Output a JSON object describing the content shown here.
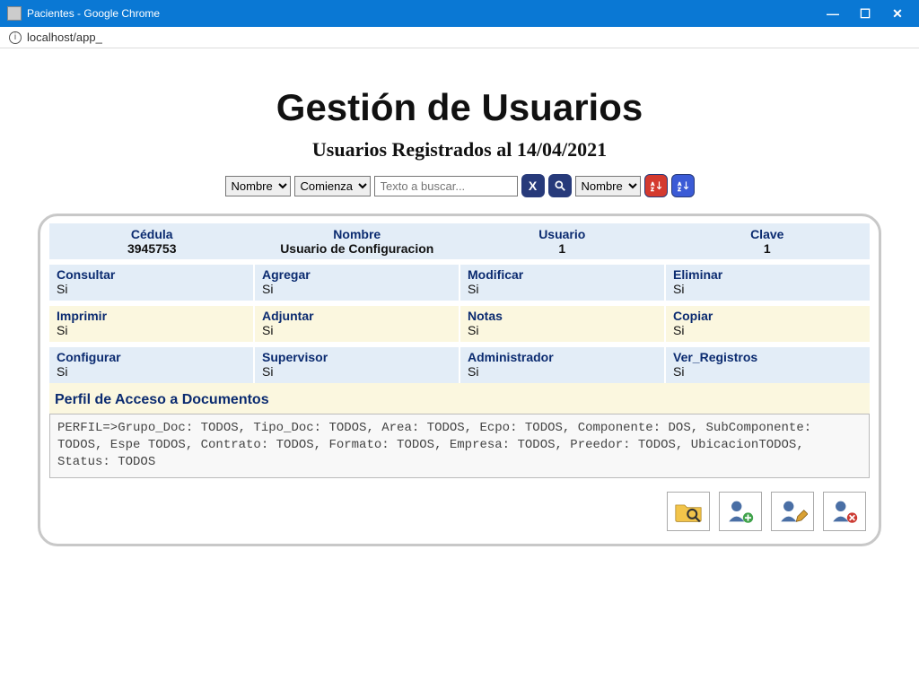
{
  "window": {
    "title": "Pacientes - Google Chrome",
    "url": "localhost/app_"
  },
  "page": {
    "title": "Gestión de Usuarios",
    "subtitle": "Usuarios Registrados al 14/04/2021"
  },
  "search": {
    "field1_option": "Nombre",
    "match_option": "Comienza",
    "placeholder": "Texto a buscar...",
    "value": "",
    "field2_option": "Nombre"
  },
  "header": {
    "cells": [
      {
        "label": "Cédula",
        "value": "3945753"
      },
      {
        "label": "Nombre",
        "value": "Usuario de Configuracion"
      },
      {
        "label": "Usuario",
        "value": "1"
      },
      {
        "label": "Clave",
        "value": "1"
      }
    ]
  },
  "perms": {
    "rows": [
      {
        "style": "blue",
        "cells": [
          {
            "label": "Consultar",
            "value": "Si"
          },
          {
            "label": "Agregar",
            "value": "Si"
          },
          {
            "label": "Modificar",
            "value": "Si"
          },
          {
            "label": "Eliminar",
            "value": "Si"
          }
        ]
      },
      {
        "style": "cream",
        "cells": [
          {
            "label": "Imprimir",
            "value": "Si"
          },
          {
            "label": "Adjuntar",
            "value": "Si"
          },
          {
            "label": "Notas",
            "value": "Si"
          },
          {
            "label": "Copiar",
            "value": "Si"
          }
        ]
      },
      {
        "style": "blue",
        "cells": [
          {
            "label": "Configurar",
            "value": "Si"
          },
          {
            "label": "Supervisor",
            "value": "Si"
          },
          {
            "label": "Administrador",
            "value": "Si"
          },
          {
            "label": "Ver_Registros",
            "value": "Si"
          }
        ]
      }
    ]
  },
  "profile": {
    "label": "Perfil de Acceso a Documentos",
    "text": "PERFIL=>Grupo_Doc: TODOS, Tipo_Doc: TODOS, Area: TODOS, Ecpo: TODOS, Componente: DOS, SubComponente: TODOS, Espe TODOS, Contrato: TODOS, Formato: TODOS, Empresa: TODOS, Preedor: TODOS, UbicacionTODOS, Status: TODOS"
  },
  "icons": {
    "clear": "X",
    "searchTitle": "search-icon",
    "sortAsc": "sort-asc-icon",
    "sortDesc": "sort-desc-icon",
    "actions": [
      {
        "name": "folder-search-icon"
      },
      {
        "name": "user-add-icon"
      },
      {
        "name": "user-edit-icon"
      },
      {
        "name": "user-delete-icon"
      }
    ]
  }
}
